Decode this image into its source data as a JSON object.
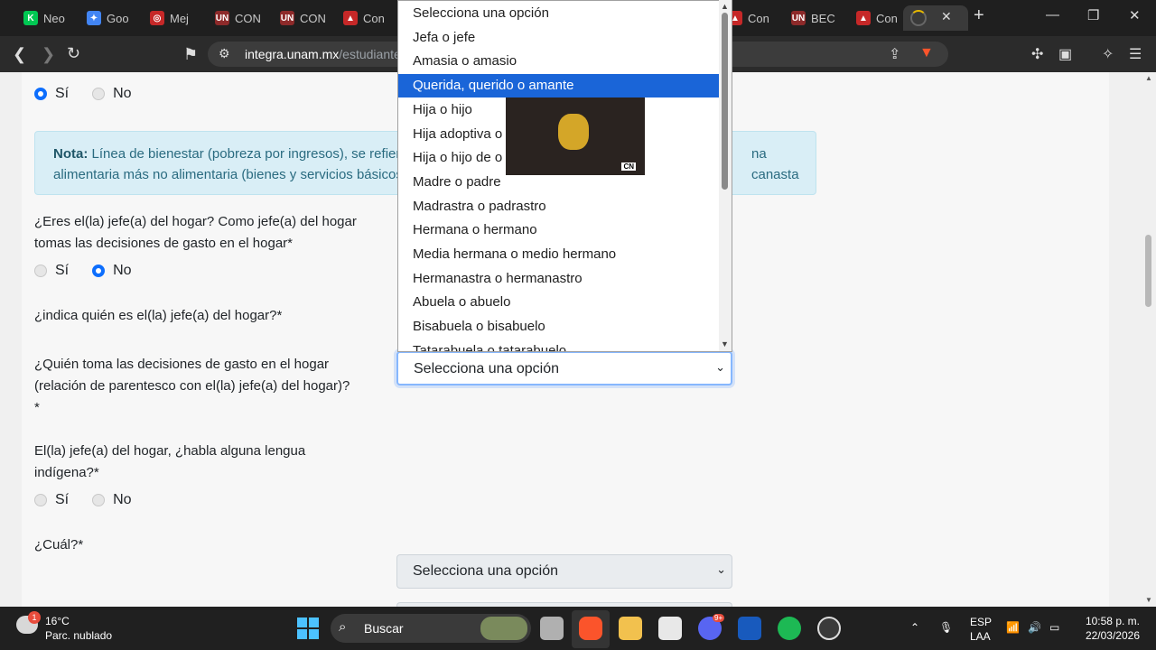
{
  "tabs": [
    {
      "label": "Neo",
      "fav_text": "K",
      "fav_color": "#00c853"
    },
    {
      "label": "Goo",
      "fav_text": "✦",
      "fav_color": "#4285f4"
    },
    {
      "label": "Mej",
      "fav_text": "◎",
      "fav_color": "#c62828"
    },
    {
      "label": "CON",
      "fav_text": "UN",
      "fav_color": "#8d2a2a"
    },
    {
      "label": "CON",
      "fav_text": "UN",
      "fav_color": "#8d2a2a"
    },
    {
      "label": "Con",
      "fav_text": "▲",
      "fav_color": "#c62828"
    },
    {
      "label": "Con",
      "fav_text": "▲",
      "fav_color": "#c62828"
    },
    {
      "label": "BEC",
      "fav_text": "UN",
      "fav_color": "#8d2a2a"
    },
    {
      "label": "Con",
      "fav_text": "▲",
      "fav_color": "#c62828"
    }
  ],
  "url": {
    "host": "integra.unam.mx",
    "path": "/estudiante"
  },
  "form": {
    "yes": "Sí",
    "no": "No",
    "note_bold": "Nota:",
    "note_line1": "Línea de bienestar (pobreza por ingresos), se refier",
    "note_line1b": "na canasta",
    "note_line2": "alimentaria más no alimentaria (bienes y servicios básicos",
    "q_jefe_1": "¿Eres el(la) jefe(a) del hogar? Como jefe(a) del hogar",
    "q_jefe_2": "tomas las decisiones de gasto en el hogar*",
    "q_indica": "¿indica quién es el(la) jefe(a) del hogar?*",
    "q_quien_1": "¿Quién toma las decisiones de gasto en el hogar",
    "q_quien_2": "(relación de parentesco con el(la) jefe(a) del hogar)?",
    "q_quien_3": "*",
    "q_lengua_1": "El(la) jefe(a) del hogar, ¿habla alguna lengua",
    "q_lengua_2": "indígena?*",
    "q_cual": "¿Cuál?*",
    "select_placeholder": "Selecciona una opción"
  },
  "dropdown_options": [
    "Selecciona una opción",
    "Jefa o jefe",
    "Amasia o amasio",
    "Querida, querido o amante",
    "Hija o hijo",
    "Hija adoptiva o",
    "Hija o hijo de o",
    "Madre o padre",
    "Madrastra o padrastro",
    "Hermana o hermano",
    "Media hermana o medio hermano",
    "Hermanastra o hermanastro",
    "Abuela o abuelo",
    "Bisabuela o bisabuelo",
    "Tatarabuela o tatarabuelo"
  ],
  "selected_option_index": 3,
  "video_badge": "CN",
  "taskbar": {
    "temp": "16°C",
    "weather": "Parc. nublado",
    "weather_badge": "1",
    "search": "Buscar",
    "lang1": "ESP",
    "lang2": "LAA",
    "time": "10:58 p. m.",
    "date": "22/03/2026",
    "discord_badge": "9+"
  }
}
